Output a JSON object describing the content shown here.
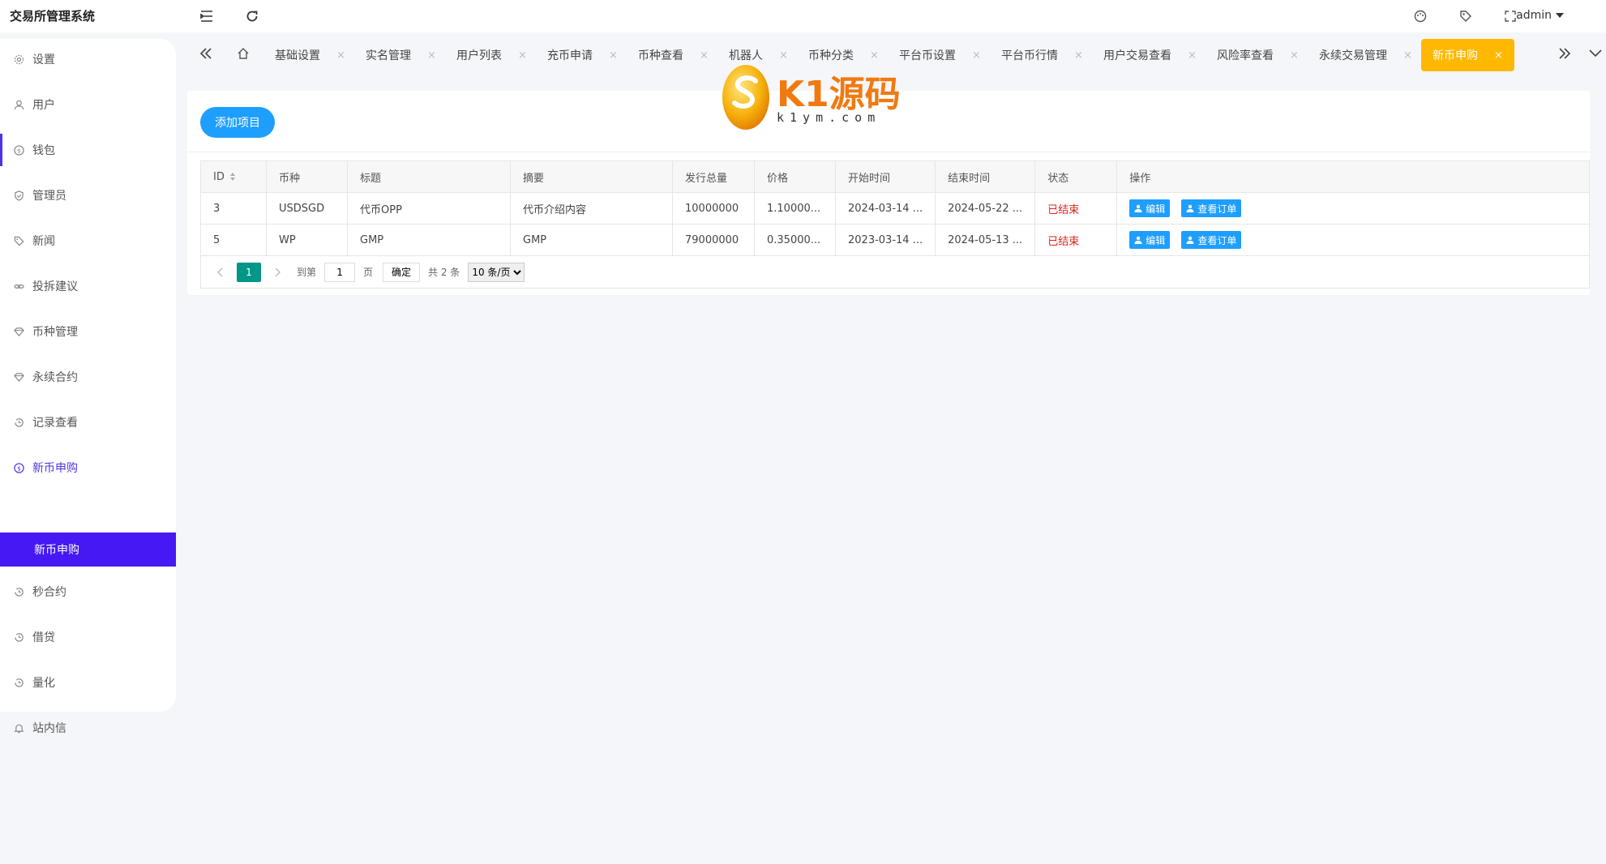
{
  "app": {
    "title": "交易所管理系统"
  },
  "header": {
    "user": "admin"
  },
  "sidebar": {
    "items": [
      {
        "label": "设置",
        "icon": "gear-icon"
      },
      {
        "label": "用户",
        "icon": "user-icon"
      },
      {
        "label": "钱包",
        "icon": "dollar-icon"
      },
      {
        "label": "管理员",
        "icon": "shield-icon"
      },
      {
        "label": "新闻",
        "icon": "tag-icon"
      },
      {
        "label": "投拆建议",
        "icon": "link-icon"
      },
      {
        "label": "币种管理",
        "icon": "diamond-icon"
      },
      {
        "label": "永续合约",
        "icon": "diamond-icon"
      },
      {
        "label": "记录查看",
        "icon": "history-icon"
      },
      {
        "label": "新币申购",
        "icon": "dollar-icon"
      },
      {
        "label": "秒合约",
        "icon": "history-icon"
      },
      {
        "label": "借贷",
        "icon": "history-icon"
      },
      {
        "label": "量化",
        "icon": "history-icon"
      },
      {
        "label": "站内信",
        "icon": "bell-icon"
      }
    ],
    "active_sub": "新币申购"
  },
  "tabs": [
    {
      "label": "基础设置"
    },
    {
      "label": "实名管理"
    },
    {
      "label": "用户列表"
    },
    {
      "label": "充币申请"
    },
    {
      "label": "币种查看"
    },
    {
      "label": "机器人"
    },
    {
      "label": "币种分类"
    },
    {
      "label": "平台币设置"
    },
    {
      "label": "平台币行情"
    },
    {
      "label": "用户交易查看"
    },
    {
      "label": "风险率查看"
    },
    {
      "label": "永续交易管理"
    },
    {
      "label": "新币申购"
    }
  ],
  "tab_close_glyph": "×",
  "toolbar": {
    "add_label": "添加项目"
  },
  "table": {
    "headers": [
      "ID",
      "币种",
      "标题",
      "摘要",
      "发行总量",
      "价格",
      "开始时间",
      "结束时间",
      "状态",
      "操作"
    ],
    "rows": [
      {
        "id": "3",
        "coin": "USDSGD",
        "title": "代币OPP",
        "summary": "代币介绍内容",
        "total": "10000000",
        "price": "1.10000...",
        "start": "2024-03-14 ...",
        "end": "2024-05-22 ...",
        "status": "已结束"
      },
      {
        "id": "5",
        "coin": "WP",
        "title": "GMP",
        "summary": "GMP",
        "total": "79000000",
        "price": "0.35000...",
        "start": "2023-03-14 ...",
        "end": "2024-05-13 ...",
        "status": "已结束"
      }
    ],
    "actions": {
      "edit": "编辑",
      "orders": "查看订单"
    }
  },
  "pagination": {
    "current": "1",
    "goto_prefix": "到第",
    "goto_value": "1",
    "goto_suffix": "页",
    "confirm": "确定",
    "total": "共 2 条",
    "page_size": "10 条/页"
  },
  "watermark": {
    "brand": "K1源码",
    "url": "k1ym.com"
  },
  "colors": {
    "accent": "#4518f4",
    "primary_button": "#1e9fff",
    "active_tab": "#ffb800",
    "pager_current": "#009688",
    "status_ended": "#e0201a"
  }
}
